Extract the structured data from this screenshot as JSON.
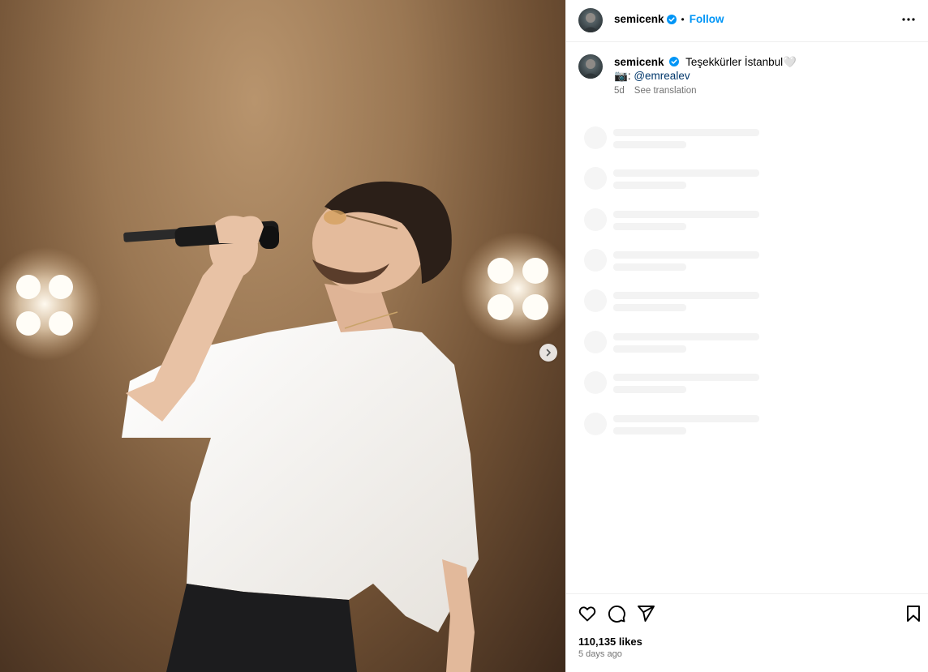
{
  "post": {
    "username": "semicenk",
    "follow_label": "Follow",
    "separator": "•",
    "caption": {
      "username": "semicenk",
      "text": "Teşekkürler İstanbul🤍",
      "camera_emoji": "📷",
      "credit_prefix": ":",
      "mention": "@emrealev"
    },
    "age_short": "5d",
    "see_translation": "See translation",
    "likes": "110,135 likes",
    "time_ago": "5 days ago"
  },
  "icons": {
    "verified": "verified-badge-icon",
    "more": "more-options-icon",
    "next": "chevron-right-icon",
    "like": "heart-icon",
    "comment": "comment-icon",
    "share": "send-icon",
    "save": "bookmark-icon"
  },
  "colors": {
    "accent": "#0095f6",
    "mention": "#00376b",
    "secondary_text": "#737373",
    "skeleton": "#f3f3f3",
    "border": "#efefef"
  }
}
